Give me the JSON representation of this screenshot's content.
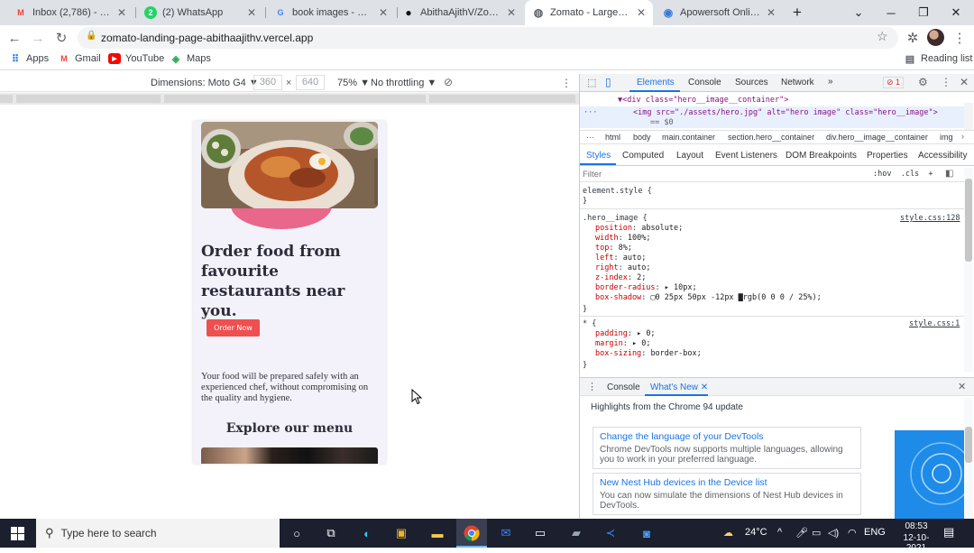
{
  "tabs": [
    {
      "title": "Inbox (2,786) - abitha",
      "favicon": "gmail-icon",
      "color": "#ea4335",
      "glyph": "M"
    },
    {
      "title": "(2) WhatsApp",
      "favicon": "whatsapp-icon",
      "color": "#25d366",
      "glyph": "2"
    },
    {
      "title": "book images - Google",
      "favicon": "google-icon",
      "color": "#4285f4",
      "glyph": "G"
    },
    {
      "title": "AbithaAjithV/Zomato",
      "favicon": "github-icon",
      "color": "#111111",
      "glyph": "●"
    },
    {
      "title": "Zomato - Largest Foo",
      "favicon": "globe-icon",
      "color": "#5f6368",
      "glyph": "◍"
    },
    {
      "title": "Apowersoft Online Sc",
      "favicon": "apowersoft-icon",
      "color": "#3a7bd5",
      "glyph": "◉"
    }
  ],
  "tab_close": "✕",
  "new_tab": "+",
  "window": {
    "dropdown": "⌄",
    "minimize": "─",
    "maximize": "❐",
    "close": "✕"
  },
  "address": {
    "url": "zomato-landing-page-abithaajithv.vercel.app"
  },
  "nav": {
    "back": "←",
    "forward": "→",
    "reload": "↻",
    "lock": "🔒",
    "star": "☆",
    "extensions": "✲",
    "menu": "⋮"
  },
  "bookmarks": [
    {
      "label": "Apps"
    },
    {
      "label": "Gmail"
    },
    {
      "label": "YouTube"
    },
    {
      "label": "Maps"
    }
  ],
  "reading_list": "Reading list",
  "device_toolbar": {
    "dimensions_label": "Dimensions: Moto G4 ▼",
    "width": "360",
    "times": "×",
    "height": "640",
    "zoom": "75% ▼",
    "throttle": "No throttling ▼",
    "menu": "⋮"
  },
  "page": {
    "headline": "Order food from favourite restaurants near you.",
    "order_button": "Order Now",
    "paragraph": "Your food will be prepared safely with an experienced chef, without compromising on the quality and hygiene.",
    "explore_heading": "Explore our menu"
  },
  "devtools": {
    "tabs": [
      "Elements",
      "Console",
      "Sources",
      "Network",
      "»"
    ],
    "error_badge": "⊘ 1",
    "close": "✕",
    "dom_line1": "▼<div class=\"hero__image__container\">",
    "dom_line2": "<img src=\"./assets/hero.jpg\" alt=\"hero image\" class=\"hero__image\">",
    "dom_line3": "== $0",
    "dom_ellipsis": "···",
    "breadcrumbs": [
      "html",
      "body",
      "main.container",
      "section.hero__container",
      "div.hero__image__container",
      "img"
    ],
    "subtabs": [
      "Styles",
      "Computed",
      "Layout",
      "Event Listeners",
      "DOM Breakpoints",
      "Properties",
      "Accessibility"
    ],
    "filter_placeholder": "Filter",
    "filter_tools": ":hov  .cls  +",
    "element_style": "element.style {",
    "close_brace": "}",
    "rule1_selector": ".hero__image {",
    "rule1_source": "style.css:128",
    "rule1_props": [
      {
        "name": "position",
        "value": "absolute;"
      },
      {
        "name": "width",
        "value": "100%;"
      },
      {
        "name": "top",
        "value": "8%;"
      },
      {
        "name": "left",
        "value": "auto;"
      },
      {
        "name": "right",
        "value": "auto;"
      },
      {
        "name": "z-index",
        "value": "2;"
      },
      {
        "name": "border-radius",
        "value": "▸ 10px;"
      },
      {
        "name": "box-shadow",
        "value": "▢0 25px 50px -12px ▇rgb(0 0 0 / 25%);"
      }
    ],
    "rule2_selector": "* {",
    "rule2_source": "style.css:1",
    "rule2_props": [
      {
        "name": "padding",
        "value": "▸ 0;"
      },
      {
        "name": "margin",
        "value": "▸ 0;"
      },
      {
        "name": "box-sizing",
        "value": "border-box;"
      }
    ],
    "drawer_tabs": [
      "Console",
      "What's New ✕"
    ],
    "drawer_headline": "Highlights from the Chrome 94 update",
    "cards": [
      {
        "title": "Change the language of your DevTools",
        "body": "Chrome DevTools now supports multiple languages, allowing you to work in your preferred language."
      },
      {
        "title": "New Nest Hub devices in the Device list",
        "body": "You can now simulate the dimensions of Nest Hub devices in DevTools."
      }
    ]
  },
  "taskbar": {
    "search_placeholder": "Type here to search",
    "weather": "24°C",
    "language": "ENG",
    "time": "08:53",
    "date": "12-10-2021"
  },
  "colors": {
    "accent": "#1a73e8",
    "order_button": "#ef4f4f",
    "hero_blob": "#e8678a"
  }
}
